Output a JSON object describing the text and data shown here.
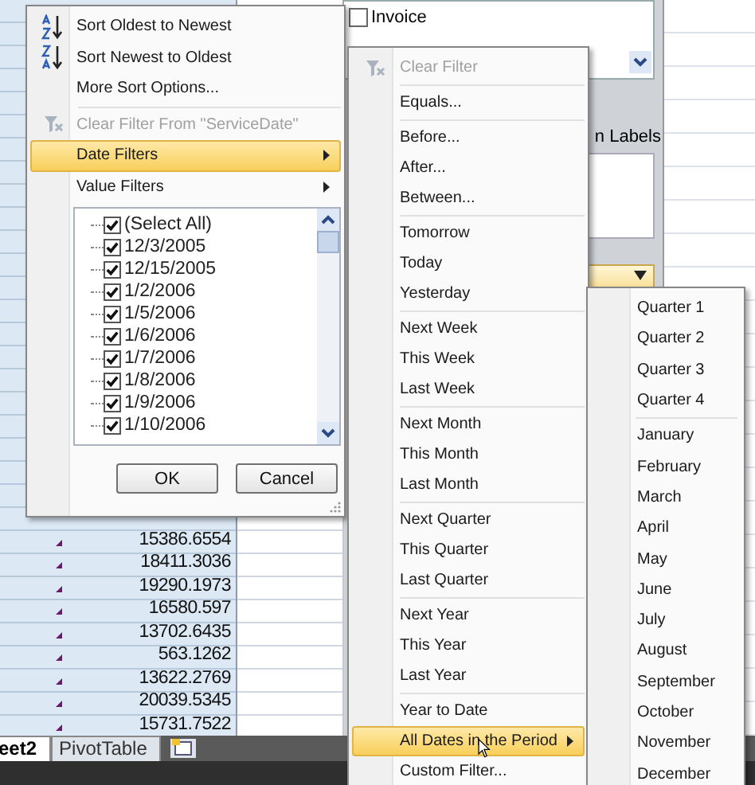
{
  "spreadsheet": {
    "values": [
      "15386.6554",
      "18411.3036",
      "19290.1973",
      "16580.597",
      "13702.6435",
      "563.1262",
      "13622.2769",
      "20039.5345",
      "15731.7522"
    ]
  },
  "sheet_tabs": [
    {
      "label": "eet2",
      "selected": true
    },
    {
      "label": "PivotTable",
      "selected": false
    }
  ],
  "field_list": {
    "fields": [
      {
        "label": "Invoice",
        "checked": false
      }
    ],
    "area_label": "n Labels"
  },
  "filter_menu": {
    "items": [
      {
        "kind": "sort-ascending",
        "label": "Sort Oldest to Newest",
        "disabled": false,
        "highlighted": false,
        "submenu": false
      },
      {
        "kind": "sort-descending",
        "label": "Sort Newest to Oldest",
        "disabled": false,
        "highlighted": false,
        "submenu": false
      },
      {
        "kind": "item",
        "label": "More Sort Options...",
        "disabled": false,
        "highlighted": false,
        "submenu": false
      },
      {
        "kind": "separator"
      },
      {
        "kind": "clear-filter",
        "label": "Clear Filter From \"ServiceDate\"",
        "disabled": true,
        "highlighted": false,
        "submenu": false
      },
      {
        "kind": "item",
        "label": "Date Filters",
        "disabled": false,
        "highlighted": true,
        "submenu": true
      },
      {
        "kind": "item",
        "label": "Value Filters",
        "disabled": false,
        "highlighted": false,
        "submenu": true
      }
    ],
    "list": [
      {
        "label": "(Select All)",
        "checked": true
      },
      {
        "label": "12/3/2005",
        "checked": true
      },
      {
        "label": "12/15/2005",
        "checked": true
      },
      {
        "label": "1/2/2006",
        "checked": true
      },
      {
        "label": "1/5/2006",
        "checked": true
      },
      {
        "label": "1/6/2006",
        "checked": true
      },
      {
        "label": "1/7/2006",
        "checked": true
      },
      {
        "label": "1/8/2006",
        "checked": true
      },
      {
        "label": "1/9/2006",
        "checked": true
      },
      {
        "label": "1/10/2006",
        "checked": true
      }
    ],
    "buttons": [
      "OK",
      "Cancel"
    ]
  },
  "date_filters_menu": {
    "items": [
      {
        "kind": "clear-filter",
        "label": "Clear Filter",
        "disabled": true,
        "highlighted": false,
        "submenu": false
      },
      {
        "kind": "separator"
      },
      {
        "kind": "item",
        "label": "Equals...",
        "disabled": false,
        "highlighted": false,
        "submenu": false
      },
      {
        "kind": "separator"
      },
      {
        "kind": "item",
        "label": "Before...",
        "disabled": false,
        "highlighted": false,
        "submenu": false
      },
      {
        "kind": "item",
        "label": "After...",
        "disabled": false,
        "highlighted": false,
        "submenu": false
      },
      {
        "kind": "item",
        "label": "Between...",
        "disabled": false,
        "highlighted": false,
        "submenu": false
      },
      {
        "kind": "separator"
      },
      {
        "kind": "item",
        "label": "Tomorrow",
        "disabled": false,
        "highlighted": false,
        "submenu": false
      },
      {
        "kind": "item",
        "label": "Today",
        "disabled": false,
        "highlighted": false,
        "submenu": false
      },
      {
        "kind": "item",
        "label": "Yesterday",
        "disabled": false,
        "highlighted": false,
        "submenu": false
      },
      {
        "kind": "separator"
      },
      {
        "kind": "item",
        "label": "Next Week",
        "disabled": false,
        "highlighted": false,
        "submenu": false
      },
      {
        "kind": "item",
        "label": "This Week",
        "disabled": false,
        "highlighted": false,
        "submenu": false
      },
      {
        "kind": "item",
        "label": "Last Week",
        "disabled": false,
        "highlighted": false,
        "submenu": false
      },
      {
        "kind": "separator"
      },
      {
        "kind": "item",
        "label": "Next Month",
        "disabled": false,
        "highlighted": false,
        "submenu": false
      },
      {
        "kind": "item",
        "label": "This Month",
        "disabled": false,
        "highlighted": false,
        "submenu": false
      },
      {
        "kind": "item",
        "label": "Last Month",
        "disabled": false,
        "highlighted": false,
        "submenu": false
      },
      {
        "kind": "separator"
      },
      {
        "kind": "item",
        "label": "Next Quarter",
        "disabled": false,
        "highlighted": false,
        "submenu": false
      },
      {
        "kind": "item",
        "label": "This Quarter",
        "disabled": false,
        "highlighted": false,
        "submenu": false
      },
      {
        "kind": "item",
        "label": "Last Quarter",
        "disabled": false,
        "highlighted": false,
        "submenu": false
      },
      {
        "kind": "separator"
      },
      {
        "kind": "item",
        "label": "Next Year",
        "disabled": false,
        "highlighted": false,
        "submenu": false
      },
      {
        "kind": "item",
        "label": "This Year",
        "disabled": false,
        "highlighted": false,
        "submenu": false
      },
      {
        "kind": "item",
        "label": "Last Year",
        "disabled": false,
        "highlighted": false,
        "submenu": false
      },
      {
        "kind": "separator"
      },
      {
        "kind": "item",
        "label": "Year to Date",
        "disabled": false,
        "highlighted": false,
        "submenu": false
      },
      {
        "kind": "item",
        "label": "All Dates in the Period",
        "disabled": false,
        "highlighted": true,
        "submenu": true
      },
      {
        "kind": "item",
        "label": "Custom Filter...",
        "disabled": false,
        "highlighted": false,
        "submenu": false
      }
    ]
  },
  "period_menu": {
    "items": [
      {
        "kind": "item",
        "label": "Quarter 1",
        "disabled": false,
        "highlighted": false,
        "submenu": false
      },
      {
        "kind": "item",
        "label": "Quarter 2",
        "disabled": false,
        "highlighted": false,
        "submenu": false
      },
      {
        "kind": "item",
        "label": "Quarter 3",
        "disabled": false,
        "highlighted": false,
        "submenu": false
      },
      {
        "kind": "item",
        "label": "Quarter 4",
        "disabled": false,
        "highlighted": false,
        "submenu": false
      },
      {
        "kind": "separator"
      },
      {
        "kind": "item",
        "label": "January",
        "disabled": false,
        "highlighted": false,
        "submenu": false
      },
      {
        "kind": "item",
        "label": "February",
        "disabled": false,
        "highlighted": false,
        "submenu": false
      },
      {
        "kind": "item",
        "label": "March",
        "disabled": false,
        "highlighted": false,
        "submenu": false
      },
      {
        "kind": "item",
        "label": "April",
        "disabled": false,
        "highlighted": false,
        "submenu": false
      },
      {
        "kind": "item",
        "label": "May",
        "disabled": false,
        "highlighted": false,
        "submenu": false
      },
      {
        "kind": "item",
        "label": "June",
        "disabled": false,
        "highlighted": false,
        "submenu": false
      },
      {
        "kind": "item",
        "label": "July",
        "disabled": false,
        "highlighted": false,
        "submenu": false
      },
      {
        "kind": "item",
        "label": "August",
        "disabled": false,
        "highlighted": false,
        "submenu": false
      },
      {
        "kind": "item",
        "label": "September",
        "disabled": false,
        "highlighted": false,
        "submenu": false
      },
      {
        "kind": "item",
        "label": "October",
        "disabled": false,
        "highlighted": false,
        "submenu": false
      },
      {
        "kind": "item",
        "label": "November",
        "disabled": false,
        "highlighted": false,
        "submenu": false
      },
      {
        "kind": "item",
        "label": "December",
        "disabled": false,
        "highlighted": false,
        "submenu": false
      }
    ]
  }
}
